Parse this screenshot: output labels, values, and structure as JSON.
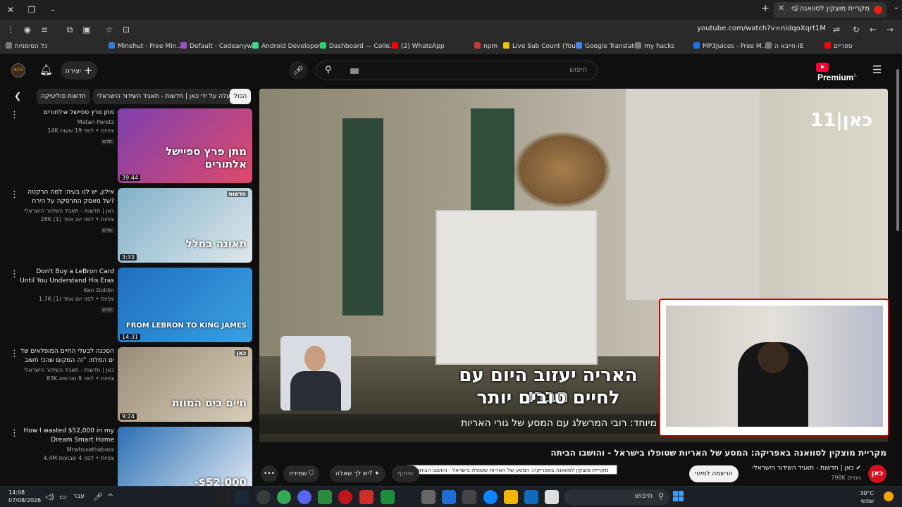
{
  "browser": {
    "tab_title": "מקריית מוצקין לסוואנה באפ",
    "url": "youtube.com/watch?v=nidqoXqrt1M",
    "bookmarks": [
      {
        "label": "כל הסימניות",
        "color": "#7a7a7a"
      },
      {
        "label": "Minehut - Free Min...",
        "color": "#2d7bd8"
      },
      {
        "label": "Default - Codeanyw...",
        "color": "#9b4dca"
      },
      {
        "label": "Android Developers",
        "color": "#3ddc84"
      },
      {
        "label": "Dashboard — Colle...",
        "color": "#25d366"
      },
      {
        "label": "(2) WhatsApp",
        "color": "#ff0000"
      },
      {
        "label": "npm",
        "color": "#cb3837"
      },
      {
        "label": "Live Sub Count (You...",
        "color": "#f2c200"
      },
      {
        "label": "Google Translate",
        "color": "#4285f4"
      },
      {
        "label": "my hacks",
        "color": "#7a7a7a"
      },
      {
        "label": "MP3Juices - Free M...",
        "color": "#1a73e8"
      },
      {
        "label": "חייבא ה-IE",
        "color": "#7a7a7a"
      },
      {
        "label": "ספריים",
        "color": "#ff0000"
      }
    ]
  },
  "header": {
    "avatar_text": "ACO",
    "create_label": "יצירה",
    "search_placeholder": "חיפוש",
    "logo_text": "Premium",
    "logo_sup": "IL"
  },
  "chips": [
    {
      "label": "הכול",
      "active": true
    },
    {
      "label": "הועלה על ידי כאן | חדשות - תאגיד השידור הישראלי",
      "active": false
    },
    {
      "label": "חדשות פוליטיקה",
      "active": false
    }
  ],
  "recommendations": [
    {
      "title": "מתן פרץ ספיישל אילתורים",
      "channel": "Matan Peretz",
      "meta": "14K צפיות • לפני 19 שעות",
      "badge": "חדש",
      "duration": "39:44",
      "thumb_text": "מתן פרץ ספיישל אלתורים",
      "thumb_colors": [
        "#7d3fb0",
        "#e04a6a"
      ]
    },
    {
      "title": "אילון, יש לנו בעיה: למה הרקטה של מאסק התרסקה על הירח?",
      "channel": "כאן | חדשות - תאגיד השידור הישראלי",
      "meta": "28K צפיות • לפני יום אחד (1)",
      "badge": "חדש",
      "duration": "3:33",
      "thumb_text": "תאונה בחלל",
      "thumb_tag": "חדשות",
      "thumb_colors": [
        "#7fb0c8",
        "#dfe8ec"
      ]
    },
    {
      "title": "Don't Buy a LeBron Card Until You Understand His Eras",
      "channel": "Ken Goldin",
      "meta": "1.7K צפיות • לפני יום אחד (1)",
      "badge": "חדש",
      "duration": "14:31",
      "thumb_text": "FROM LEBRON TO KING JAMES",
      "thumb_colors": [
        "#1e6fbf",
        "#3aa0e0"
      ]
    },
    {
      "title": "הסכנה לבעלי החיים המופלאים של ים המלח: \"זה המקום שהכי חשוב לשמור...",
      "channel": "כאן | חדשות - תאגיד השידור הישראלי",
      "meta": "83K צפיות • לפני 9 חודשים",
      "badge": "",
      "duration": "9:24",
      "thumb_text": "חיים בים המוות",
      "thumb_tag": "כאן",
      "thumb_colors": [
        "#9a8c78",
        "#d8cdb8"
      ]
    },
    {
      "title": "How I wasted $52,000 in my Dream Smart Home",
      "channel": "Mrwhosetheboss",
      "meta": "4.4M צפיות • לפני 4 שבועות",
      "badge": "",
      "duration": "",
      "thumb_text": "-$52,000",
      "thumb_colors": [
        "#2a6fb5",
        "#e8eef5"
      ]
    }
  ],
  "player": {
    "brand": "כאן|11",
    "subtitle_line1": "האריה יעזוב היום עם חברו",
    "subtitle_line2": "לחיים טובים יותר",
    "ticker": "מיוחד: רובי המרשלג עם המסע של גורי האריות"
  },
  "video": {
    "title": "מקריית מוצקין לסוואנה באפריקה: המסע של האריות שטופלו בישראל - והושבו הביתה",
    "tooltip": "מקריית מוצקין לסוואנה באפריקה: המסע של האריות שטופלו בישראל - והושבו הביתה",
    "channel": "כאן | חדשות - תאגיד השידור הישראלי",
    "subscribers": "798K מנויים",
    "subscribe_label": "הרשמה למינוי",
    "channel_icon_text": "כאן",
    "actions": {
      "more": "•••",
      "save": "שמירה",
      "ask": "יש לך שאלה?",
      "share": "שיתוף"
    }
  },
  "taskbar": {
    "time": "14:08",
    "date": "07/08/2026",
    "lang": "עבר",
    "search_label": "חיפוש",
    "temp": "30°C",
    "weather": "שמשי"
  }
}
